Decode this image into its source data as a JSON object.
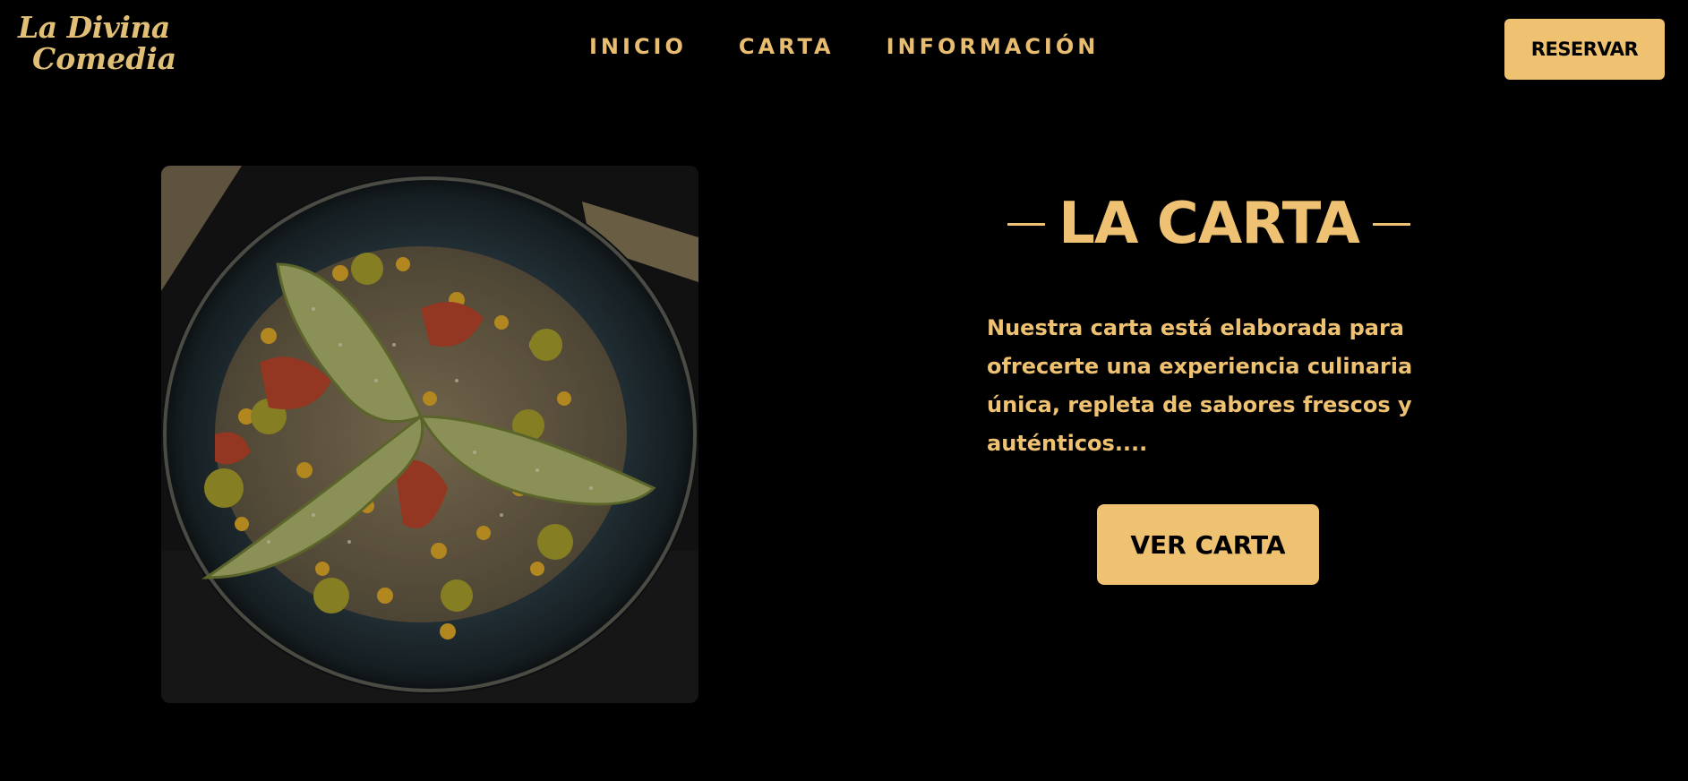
{
  "brand": {
    "logo_line1": "La Divina",
    "logo_line2": "Comedia",
    "color": "#e2bf77"
  },
  "nav": {
    "items": [
      {
        "label": "INICIO"
      },
      {
        "label": "CARTA"
      },
      {
        "label": "INFORMACIÓN"
      }
    ]
  },
  "header": {
    "reserve_label": "RESERVAR"
  },
  "section": {
    "title": "LA CARTA",
    "description": "Nuestra carta está elaborada para ofrecerte una experiencia culinaria única, repleta de sabores frescos y auténticos....",
    "cta_label": "VER CARTA"
  },
  "colors": {
    "background": "#000000",
    "accent": "#efc272",
    "button_text": "#000000"
  },
  "image": {
    "subject": "dish-photo"
  }
}
